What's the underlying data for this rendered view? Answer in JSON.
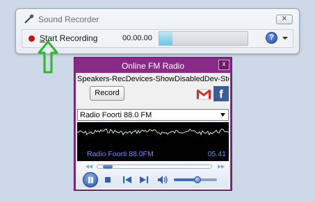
{
  "sound_recorder": {
    "title": "Sound Recorder",
    "close_label": "✕",
    "record_label": "Start Recording",
    "time": "00.00.00",
    "level_fraction": 0.15,
    "help_label": "?",
    "icons": {
      "title": "microphone-icon",
      "record": "record-dot-icon",
      "help": "help-icon",
      "menu": "chevron-down-icon"
    }
  },
  "annotation": {
    "icon": "up-arrow-icon",
    "color": "#2db52d"
  },
  "fm_radio": {
    "title": "Online FM Radio",
    "close_label": "x",
    "device": "Speakers-RecDevices-ShowDisabledDev-Stereo",
    "record_label": "Record",
    "station_select": "Radio Foorti 88.0 FM",
    "display_station": "Radio Foorti 88.0FM",
    "display_time": "05.41",
    "seek_fraction": 0.05,
    "volume_fraction": 0.55,
    "share_icons": [
      "gmail-icon",
      "facebook-icon"
    ],
    "facebook_letter": "f",
    "controls": [
      "pause-icon",
      "stop-icon",
      "previous-icon",
      "next-icon",
      "speaker-icon"
    ],
    "colors": {
      "frame": "#8a2a88",
      "display": "#000000",
      "wave": "#d9f2b0",
      "display_text": "#6f8ef5"
    }
  }
}
